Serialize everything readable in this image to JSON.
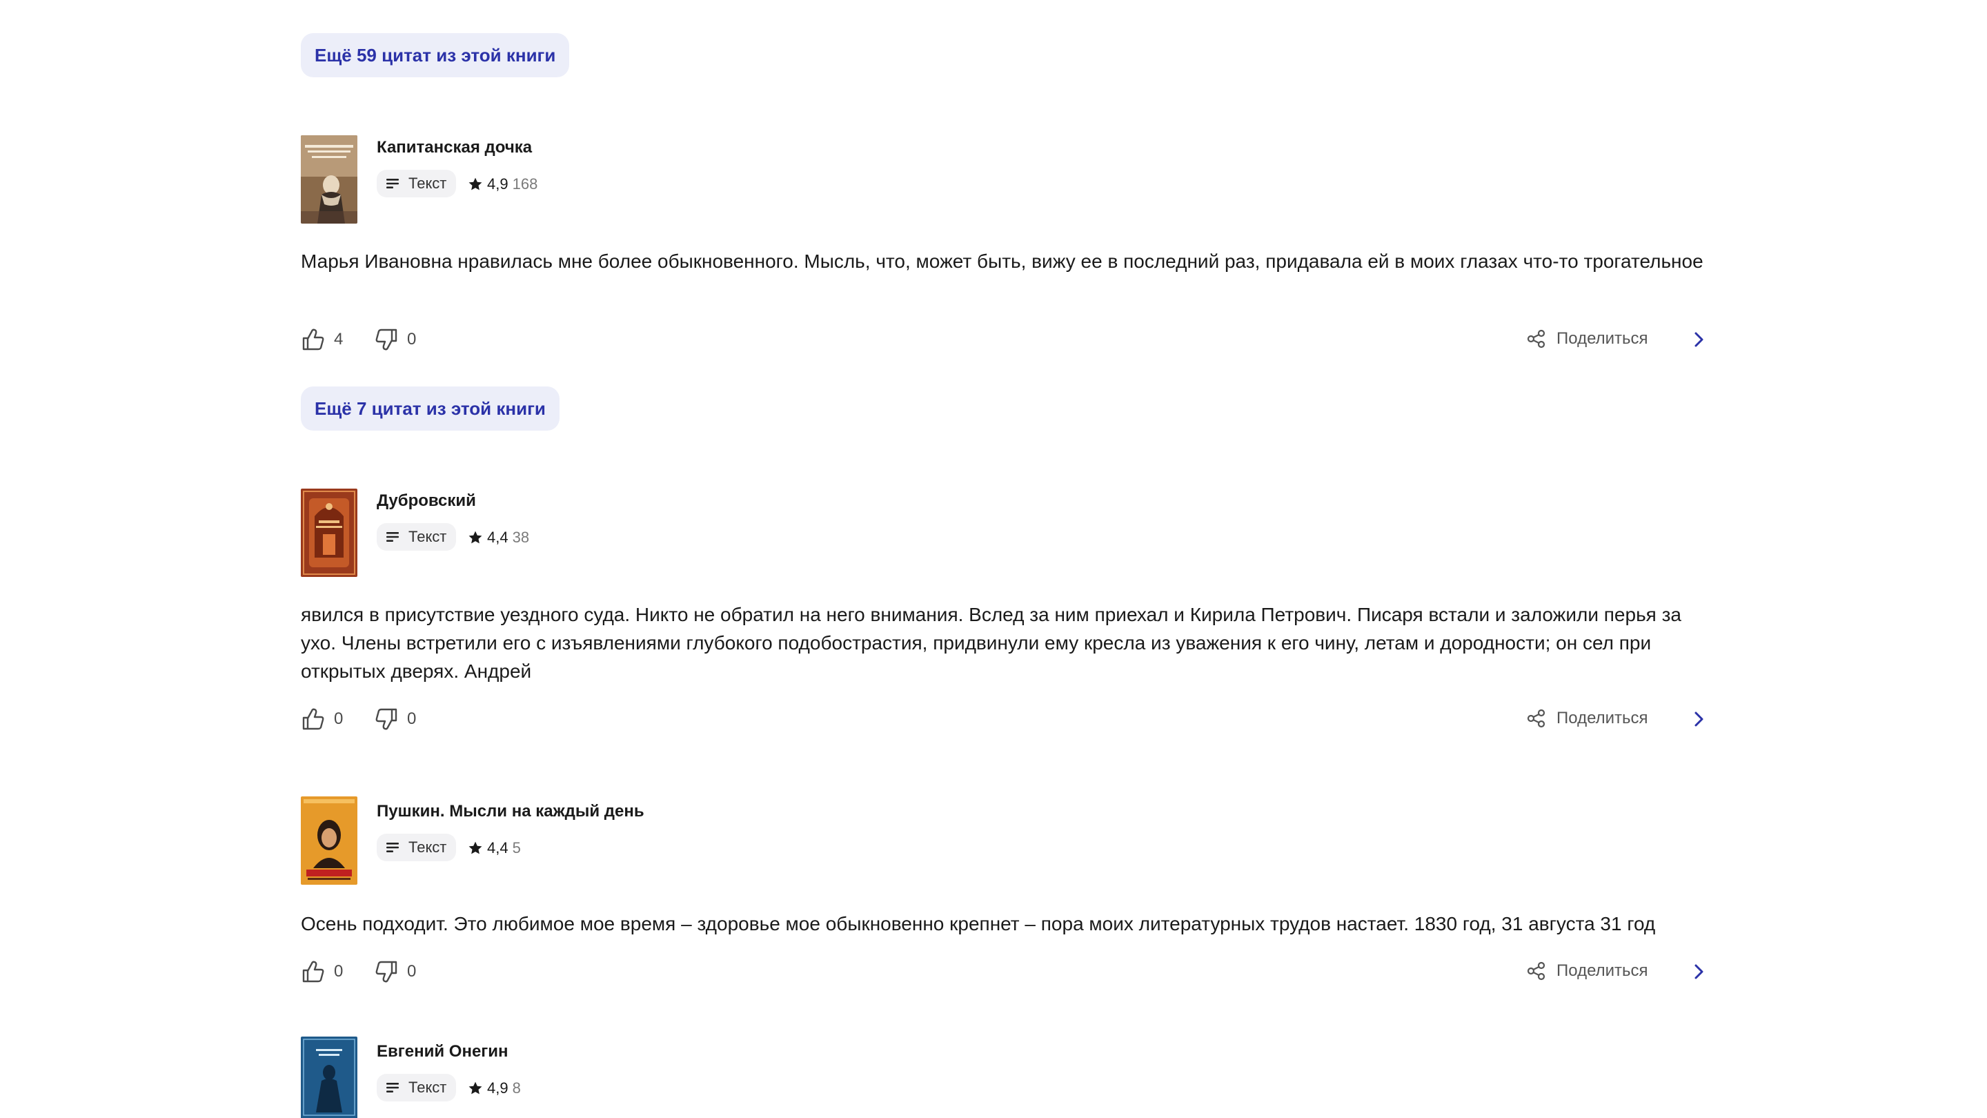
{
  "theme": {
    "accent": "#2b32a8",
    "button_bg": "#eceef9",
    "chip_bg": "#f2f2f4"
  },
  "more_buttons": [
    {
      "label": "Ещё 59 цитат из этой книги"
    },
    {
      "label": "Ещё 7 цитат из этой книги"
    }
  ],
  "quotes": [
    {
      "book_title": "Капитанская дочка",
      "type_label": "Текст",
      "type_icon": "text-lines-icon",
      "rating": "4,9",
      "rating_count": "168",
      "text": "Марья Ивановна нравилась мне более обыкновенного. Мысль, что, может быть, вижу ее в последний раз, придавала ей в  моих глазах что-то трогательное",
      "likes": "4",
      "dislikes": "0",
      "share_label": "Поделиться"
    },
    {
      "book_title": "Дубровский",
      "type_label": "Текст",
      "type_icon": "text-lines-icon",
      "rating": "4,4",
      "rating_count": "38",
      "text": "явился в присутствие уездного суда. Никто не обратил на него внимания. Вслед за ним приехал и Кирила Петрович. Писаря встали и заложили перья за ухо. Члены встретили его с изъявлениями глубокого подобострастия, придвинули ему кресла из уважения к его чину, летам и дородности; он сел при открытых дверях. Андрей",
      "likes": "0",
      "dislikes": "0",
      "share_label": "Поделиться"
    },
    {
      "book_title": "Пушкин. Мысли на каждый день",
      "type_label": "Текст",
      "type_icon": "text-lines-icon",
      "rating": "4,4",
      "rating_count": "5",
      "text": "Осень подходит. Это любимое мое время – здоровье мое обыкновенно крепнет – пора моих литературных трудов настает. 1830 год, 31 августа 31 год",
      "likes": "0",
      "dislikes": "0",
      "share_label": "Поделиться"
    },
    {
      "book_title": "Евгений Онегин",
      "type_label": "Текст",
      "type_icon": "text-lines-icon",
      "rating": "4,9",
      "rating_count": "8"
    }
  ]
}
